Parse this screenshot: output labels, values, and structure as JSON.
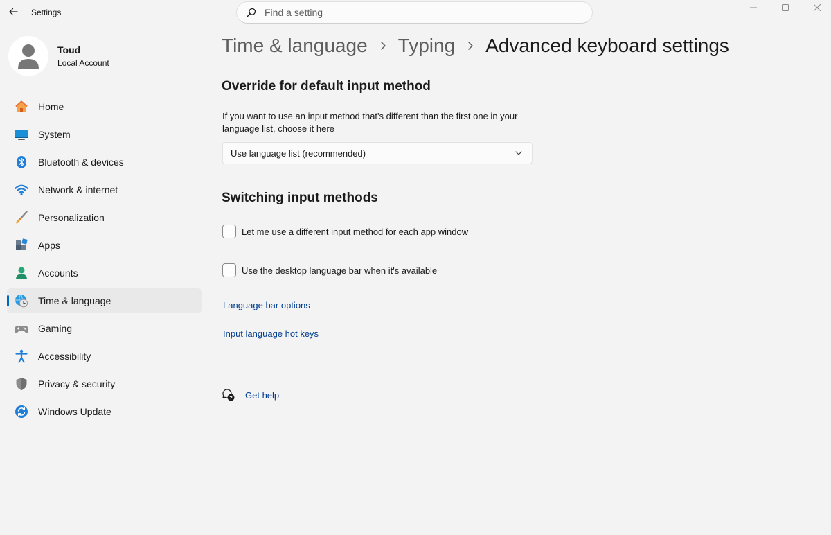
{
  "window": {
    "title": "Settings",
    "controls": {
      "minimize": "minimize",
      "maximize": "maximize",
      "close": "close"
    }
  },
  "search": {
    "placeholder": "Find a setting",
    "value": ""
  },
  "profile": {
    "name": "Toud",
    "account_type": "Local Account"
  },
  "sidebar": {
    "active_index": 7,
    "items": [
      {
        "label": "Home",
        "icon": "home-icon"
      },
      {
        "label": "System",
        "icon": "system-icon"
      },
      {
        "label": "Bluetooth & devices",
        "icon": "bluetooth-icon"
      },
      {
        "label": "Network & internet",
        "icon": "wifi-icon"
      },
      {
        "label": "Personalization",
        "icon": "brush-icon"
      },
      {
        "label": "Apps",
        "icon": "apps-icon"
      },
      {
        "label": "Accounts",
        "icon": "accounts-icon"
      },
      {
        "label": "Time & language",
        "icon": "time-language-icon"
      },
      {
        "label": "Gaming",
        "icon": "gamepad-icon"
      },
      {
        "label": "Accessibility",
        "icon": "accessibility-icon"
      },
      {
        "label": "Privacy & security",
        "icon": "shield-icon"
      },
      {
        "label": "Windows Update",
        "icon": "update-icon"
      }
    ]
  },
  "breadcrumb": [
    "Time & language",
    "Typing",
    "Advanced keyboard settings"
  ],
  "override": {
    "title": "Override for default input method",
    "description": "If you want to use an input method that's different than the first one in your language list, choose it here",
    "dropdown_value": "Use language list (recommended)"
  },
  "switching": {
    "title": "Switching input methods",
    "options": [
      {
        "label": "Let me use a different input method for each app window",
        "checked": false
      },
      {
        "label": "Use the desktop language bar when it's available",
        "checked": false
      }
    ]
  },
  "links": {
    "language_bar_options": "Language bar options",
    "input_language_hot_keys": "Input language hot keys"
  },
  "help": {
    "label": "Get help"
  },
  "colors": {
    "accent": "#0067c0",
    "link": "#003e92",
    "background": "#f3f3f3"
  }
}
